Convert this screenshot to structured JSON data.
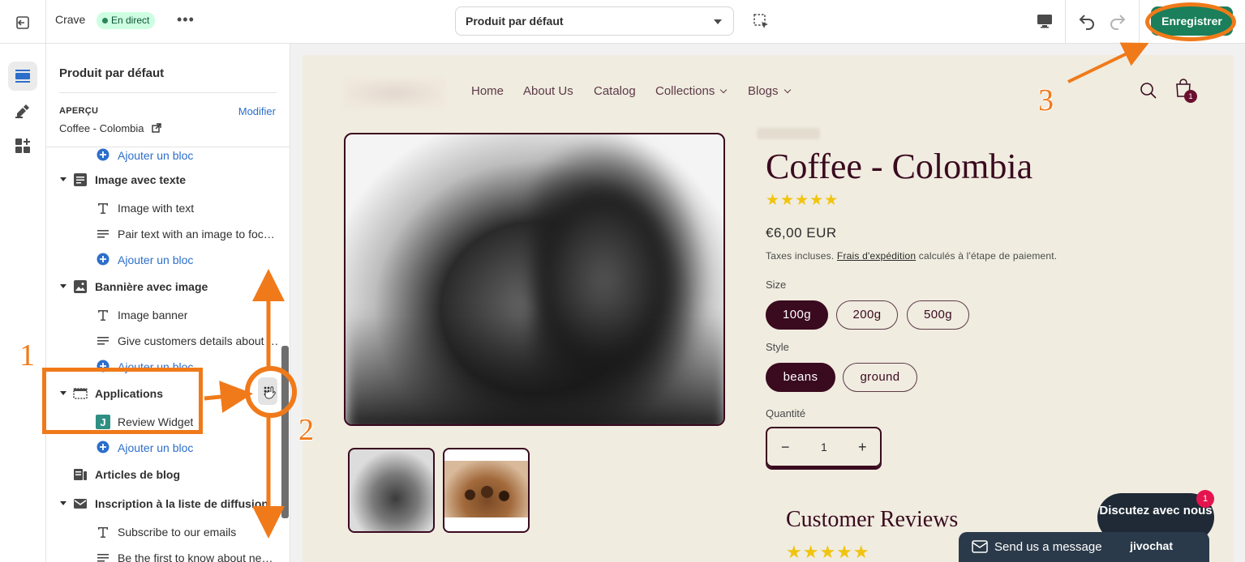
{
  "topbar": {
    "store_name": "Crave",
    "live_badge": "En direct",
    "more": "•••",
    "template": "Produit par défaut",
    "save_label": "Enregistrer"
  },
  "sidebar": {
    "title": "Produit par défaut",
    "preview_label": "APERÇU",
    "modify_link": "Modifier",
    "preview_product": "Coffee - Colombia",
    "rows": [
      {
        "type": "add",
        "label": "Ajouter un bloc"
      },
      {
        "type": "section",
        "label": "Image avec texte",
        "icon": "image-text-icon"
      },
      {
        "type": "block",
        "label": "Image with text",
        "icon": "text-icon"
      },
      {
        "type": "block",
        "label": "Pair text with an image to focu…",
        "icon": "paragraph-icon"
      },
      {
        "type": "add",
        "label": "Ajouter un bloc"
      },
      {
        "type": "section",
        "label": "Bannière avec image",
        "icon": "image-icon"
      },
      {
        "type": "block",
        "label": "Image banner",
        "icon": "text-icon"
      },
      {
        "type": "block",
        "label": "Give customers details about …",
        "icon": "paragraph-icon"
      },
      {
        "type": "add",
        "label": "Ajouter un bloc"
      },
      {
        "type": "section",
        "label": "Applications",
        "icon": "apps-icon"
      },
      {
        "type": "block",
        "label": "Review Widget",
        "icon": "app-j-icon"
      },
      {
        "type": "add",
        "label": "Ajouter un bloc"
      },
      {
        "type": "section",
        "label": "Articles de blog",
        "icon": "blog-icon"
      },
      {
        "type": "section",
        "label": "Inscription à la liste de diffusion",
        "icon": "email-icon"
      },
      {
        "type": "block",
        "label": "Subscribe to our emails",
        "icon": "text-icon"
      },
      {
        "type": "block",
        "label": "Be the first to know about new…",
        "icon": "paragraph-icon"
      }
    ]
  },
  "store": {
    "nav": [
      "Home",
      "About Us",
      "Catalog",
      "Collections",
      "Blogs"
    ],
    "cart_count": "1",
    "product_title": "Coffee - Colombia",
    "stars": "★★★★★",
    "price": "€6,00 EUR",
    "tax_prefix": "Taxes incluses.",
    "tax_link": "Frais d'expédition",
    "tax_suffix": "calculés à l'étape de paiement.",
    "size_label": "Size",
    "sizes": [
      "100g",
      "200g",
      "500g"
    ],
    "style_label": "Style",
    "styles": [
      "beans",
      "ground"
    ],
    "qty_label": "Quantité",
    "qty_minus": "−",
    "qty_value": "1",
    "qty_plus": "+",
    "reviews_title": "Customer Reviews",
    "reviews_stars": "★★★★★"
  },
  "chat": {
    "bubble": "Discutez avec nous",
    "badge": "1",
    "bar_text": "Send us a message",
    "brand": "jivochat"
  },
  "annotations": {
    "one": "1",
    "two": "2",
    "three": "3",
    "color": "#f07a1a"
  }
}
